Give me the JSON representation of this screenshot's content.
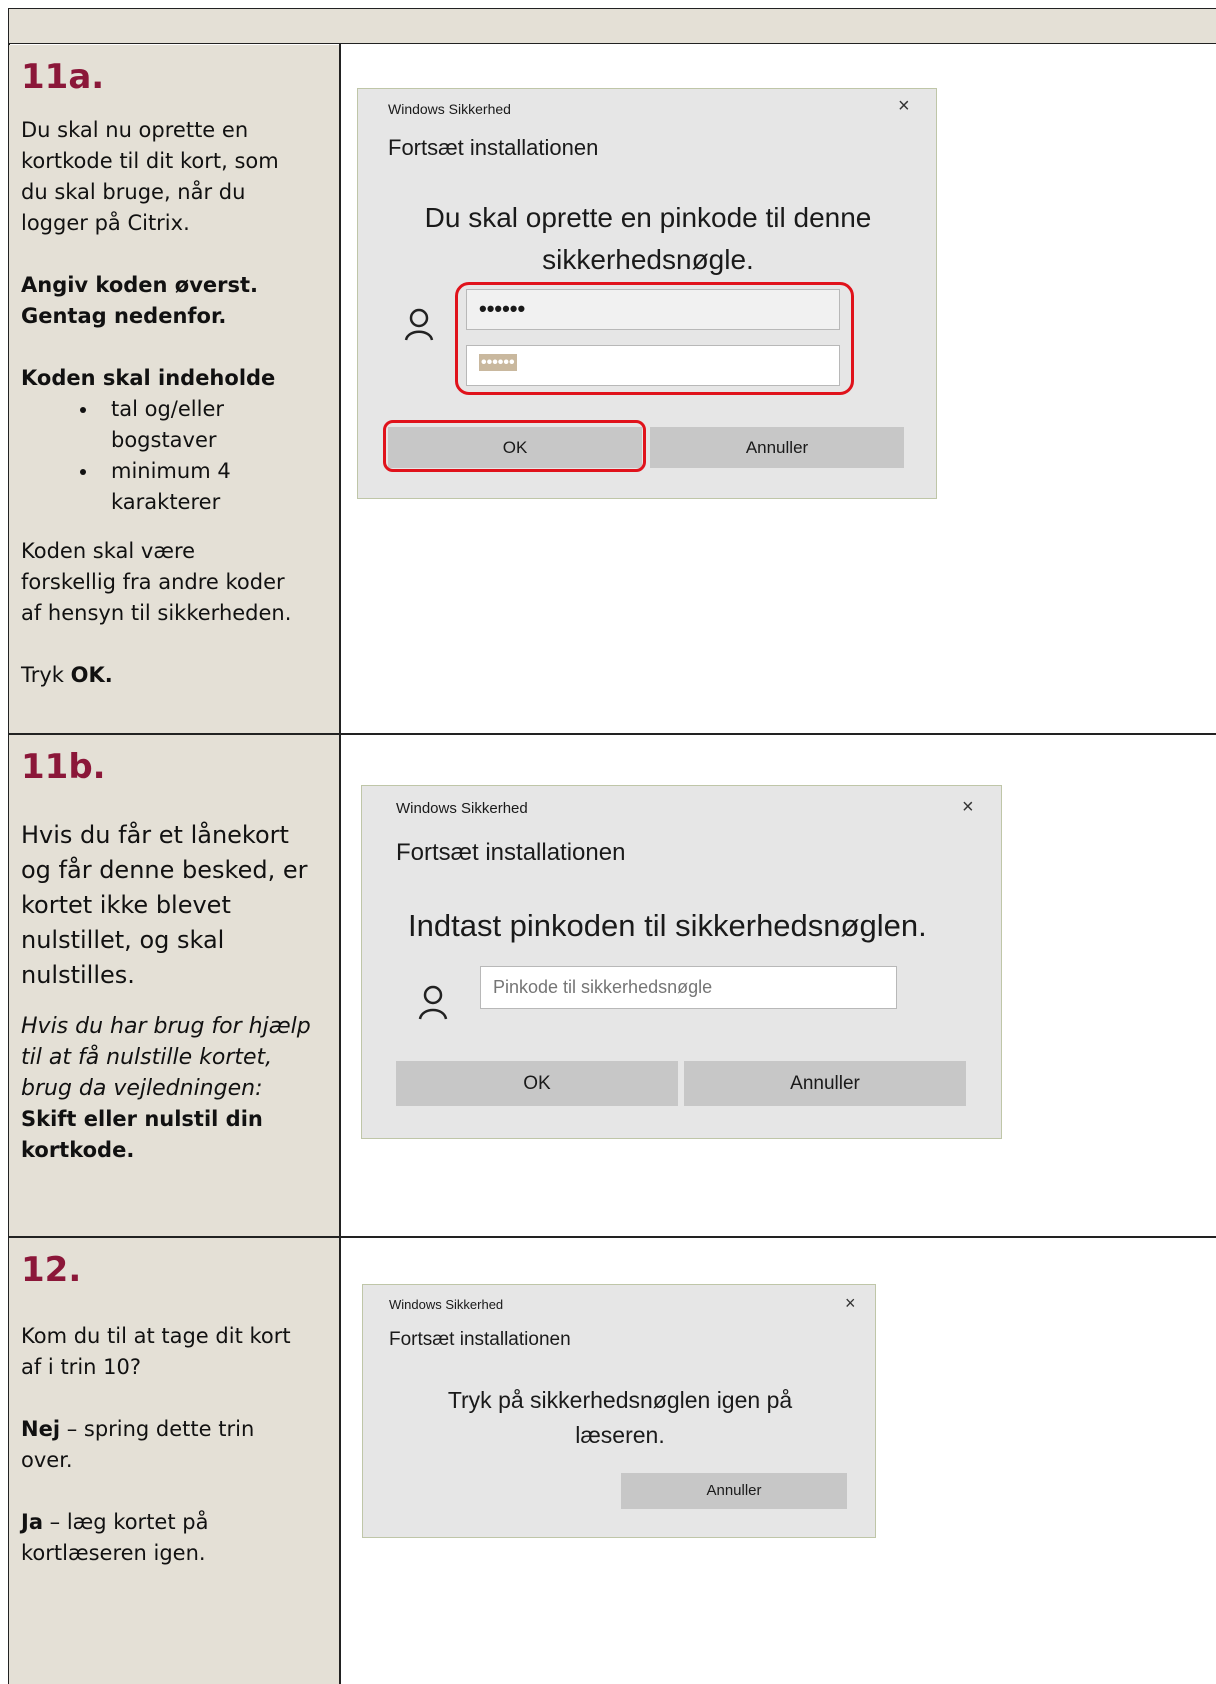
{
  "step11a": {
    "number": "11a.",
    "p1": [
      "Du skal nu oprette en",
      "kortkode til dit kort, som",
      "du skal bruge, når du",
      "logger på Citrix."
    ],
    "bold1": [
      "Angiv koden øverst.",
      "Gentag nedenfor."
    ],
    "bold2": "Koden skal indeholde",
    "bullets": [
      [
        "tal og/eller",
        "bogstaver"
      ],
      [
        "minimum 4",
        "karakterer"
      ]
    ],
    "p2": [
      "Koden skal være",
      "forskellig fra andre koder",
      "af hensyn til sikkerheden."
    ],
    "press_prefix": "Tryk ",
    "press_bold": "OK.",
    "dialog": {
      "window_title": "Windows Sikkerhed",
      "close": "×",
      "subtitle": "Fortsæt installationen",
      "message_l1": "Du skal oprette en pinkode til denne",
      "message_l2": "sikkerhedsnøgle.",
      "pin_value": "••••••",
      "confirm_value": "••••••",
      "ok": "OK",
      "cancel": "Annuller",
      "highlight_color": "#e0121b"
    }
  },
  "step11b": {
    "number": "11b.",
    "p1": [
      "Hvis du får et lånekort",
      "og får denne besked, er",
      "kortet ikke blevet",
      "nulstillet, og skal",
      "nulstilles."
    ],
    "italic": [
      "Hvis du har brug for hjælp",
      "til at få nulstille kortet,",
      "brug da vejledningen:"
    ],
    "bold": [
      "Skift eller nulstil din",
      "kortkode."
    ],
    "dialog": {
      "window_title": "Windows Sikkerhed",
      "close": "×",
      "subtitle": "Fortsæt installationen",
      "message": "Indtast pinkoden til sikkerhedsnøglen.",
      "pin_placeholder": "Pinkode til sikkerhedsnøgle",
      "ok": "OK",
      "cancel": "Annuller"
    }
  },
  "step12": {
    "number": "12.",
    "p1": [
      "Kom du til at tage dit kort",
      "af i trin 10?"
    ],
    "no_bold": "Nej",
    "no_rest": " – spring dette trin",
    "no_rest2": "over.",
    "yes_bold": "Ja",
    "yes_rest": " – læg kortet på",
    "yes_rest2": "kortlæseren igen.",
    "dialog": {
      "window_title": "Windows Sikkerhed",
      "close": "×",
      "subtitle": "Fortsæt installationen",
      "message_l1": "Tryk på sikkerhedsnøglen igen på",
      "message_l2": "læseren.",
      "cancel": "Annuller"
    }
  },
  "colors": {
    "step_number": "#8b1739",
    "left_column": "#e4e0d6",
    "dialog_bg": "#e6e6e6",
    "button": "#c7c7c7"
  }
}
